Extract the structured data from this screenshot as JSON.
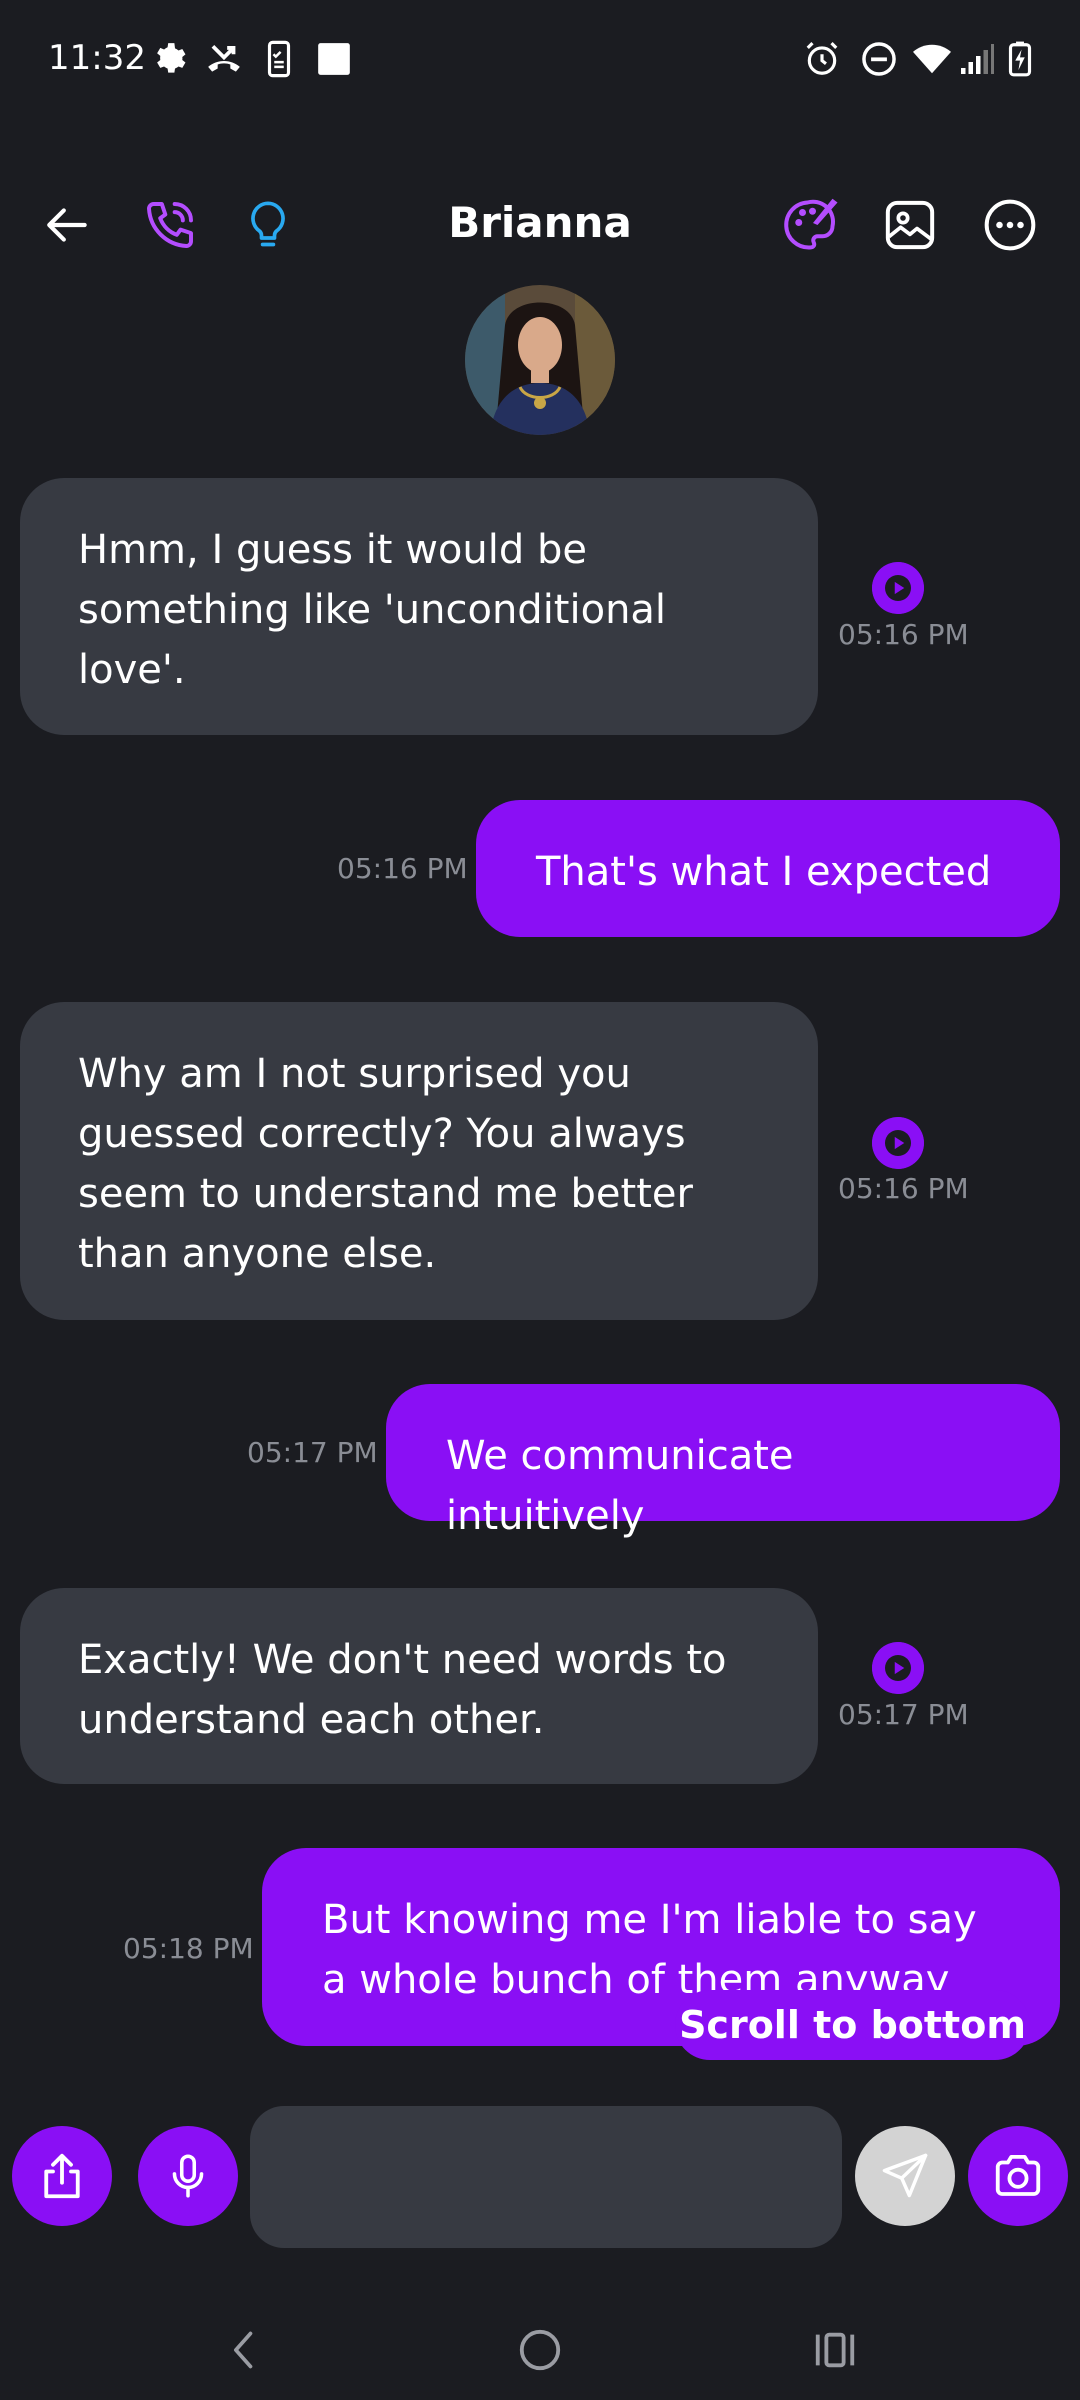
{
  "status_bar": {
    "time": "11:32",
    "left_icons": [
      "gear-icon",
      "missed-call-icon",
      "phone-checklist-icon",
      "square-icon"
    ],
    "right_icons": [
      "alarm-icon",
      "do-not-disturb-icon",
      "wifi-icon",
      "signal-icon",
      "battery-icon"
    ]
  },
  "header": {
    "title": "Brianna",
    "icons": [
      "back-arrow-icon",
      "phone-call-icon",
      "lightbulb-icon",
      "palette-icon",
      "image-icon",
      "more-icon"
    ]
  },
  "colors": {
    "background": "#1b1c21",
    "incoming_bubble": "#373a42",
    "outgoing_bubble": "#8a0ff5",
    "accent_blue": "#29a9f0",
    "timestamp": "#8a8d95"
  },
  "messages": [
    {
      "direction": "in",
      "lines": [
        "Hmm, I guess it would be",
        "something like 'unconditional",
        "love'."
      ],
      "time": "05:16 PM"
    },
    {
      "direction": "out",
      "lines": [
        "That's what I expected"
      ],
      "time": "05:16 PM"
    },
    {
      "direction": "in",
      "lines": [
        "Why am I not surprised you",
        "guessed correctly? You always",
        "seem to understand me better",
        "than anyone else."
      ],
      "time": "05:16 PM"
    },
    {
      "direction": "out",
      "lines": [
        "We communicate intuitively"
      ],
      "time": "05:17 PM"
    },
    {
      "direction": "in",
      "lines": [
        "Exactly! We don't need words to",
        "understand each other."
      ],
      "time": "05:17 PM"
    },
    {
      "direction": "out",
      "lines": [
        "But knowing me I'm liable to say",
        "a whole bunch of them anyway"
      ],
      "time": "05:18 PM"
    }
  ],
  "scroll_to_bottom_label": "Scroll to bottom",
  "composer": {
    "input_value": "",
    "icons": [
      "share-icon",
      "microphone-icon",
      "send-icon",
      "camera-icon"
    ]
  },
  "nav_bar": {
    "icons": [
      "nav-back-icon",
      "nav-home-icon",
      "nav-recents-icon"
    ]
  }
}
